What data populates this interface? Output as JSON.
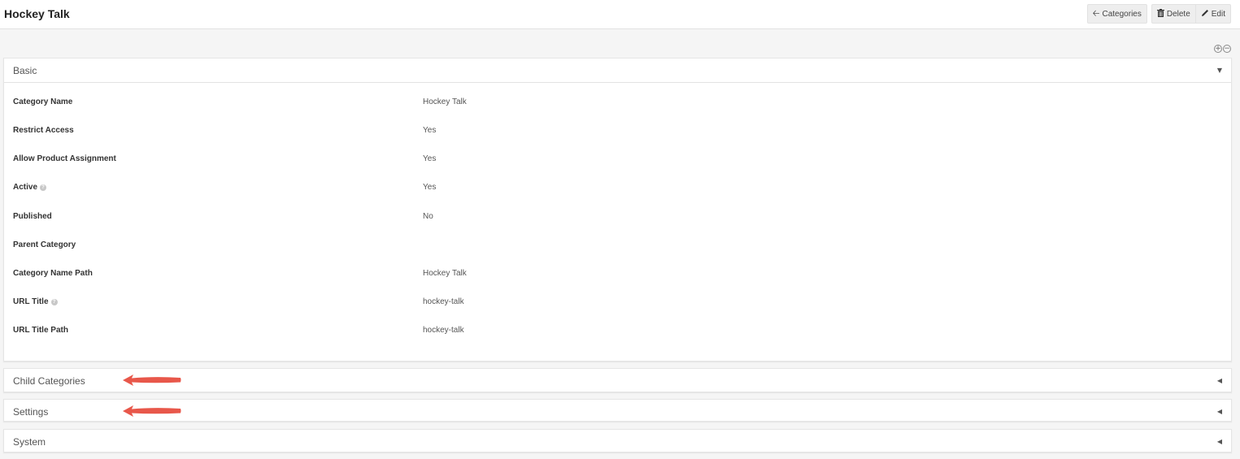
{
  "header": {
    "title": "Hockey Talk",
    "buttons": {
      "categories": "Categories",
      "delete": "Delete",
      "edit": "Edit"
    }
  },
  "icons": {
    "categories": "arrow-left-icon",
    "delete": "trash-icon",
    "edit": "pencil-icon",
    "expand_all": "expand-all-icon",
    "collapse_all": "collapse-all-icon",
    "help": "question-circle-icon",
    "caret_down": "caret-down-icon",
    "caret_left": "caret-left-icon"
  },
  "panels": {
    "basic": {
      "title": "Basic",
      "state": "expanded",
      "fields": [
        {
          "label": "Category Name",
          "value": "Hockey Talk",
          "help": false
        },
        {
          "label": "Restrict Access",
          "value": "Yes",
          "help": false
        },
        {
          "label": "Allow Product Assignment",
          "value": "Yes",
          "help": false
        },
        {
          "label": "Active",
          "value": "Yes",
          "help": true
        },
        {
          "label": "Published",
          "value": "No",
          "help": false
        },
        {
          "label": "Parent Category",
          "value": "",
          "help": false
        },
        {
          "label": "Category Name Path",
          "value": "Hockey Talk",
          "help": false
        },
        {
          "label": "URL Title",
          "value": "hockey-talk",
          "help": true
        },
        {
          "label": "URL Title Path",
          "value": "hockey-talk",
          "help": false
        }
      ]
    },
    "child_categories": {
      "title": "Child Categories",
      "state": "collapsed"
    },
    "settings": {
      "title": "Settings",
      "state": "collapsed"
    },
    "system": {
      "title": "System",
      "state": "collapsed"
    }
  },
  "colors": {
    "annotation_arrow": "#e8574a",
    "page_bg": "#f5f5f5",
    "button_bg": "#eeeeee"
  }
}
